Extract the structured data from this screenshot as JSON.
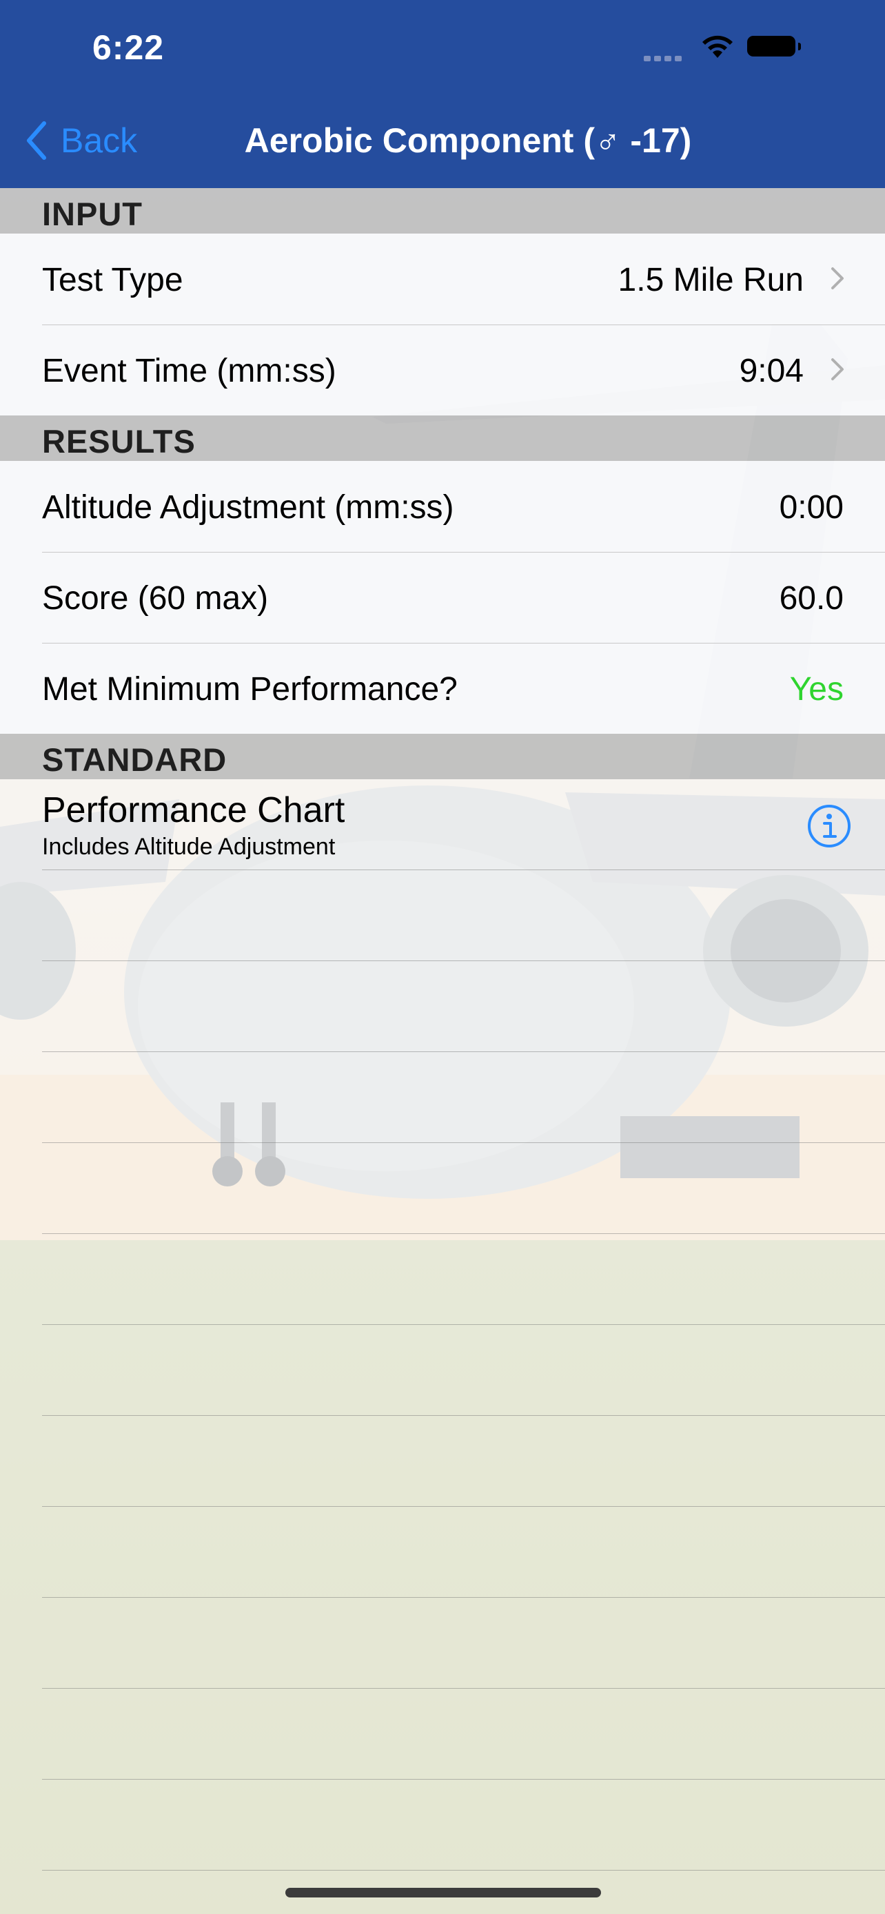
{
  "status_bar": {
    "time": "6:22"
  },
  "nav": {
    "back_label": "Back",
    "title": "Aerobic Component (♂ -17)"
  },
  "sections": {
    "input": {
      "header": "INPUT",
      "rows": [
        {
          "label": "Test Type",
          "value": "1.5 Mile Run"
        },
        {
          "label": "Event Time (mm:ss)",
          "value": "9:04"
        }
      ]
    },
    "results": {
      "header": "RESULTS",
      "rows": [
        {
          "label": "Altitude Adjustment (mm:ss)",
          "value": "0:00"
        },
        {
          "label": "Score (60 max)",
          "value": "60.0"
        },
        {
          "label": "Met Minimum Performance?",
          "value": "Yes"
        }
      ]
    },
    "standard": {
      "header": "STANDARD",
      "performance_chart": {
        "title": "Performance Chart",
        "subtitle": "Includes Altitude Adjustment"
      }
    }
  },
  "colors": {
    "nav_bar": "#254d9e",
    "accent": "#2a8cff",
    "success": "#2fd42f"
  }
}
